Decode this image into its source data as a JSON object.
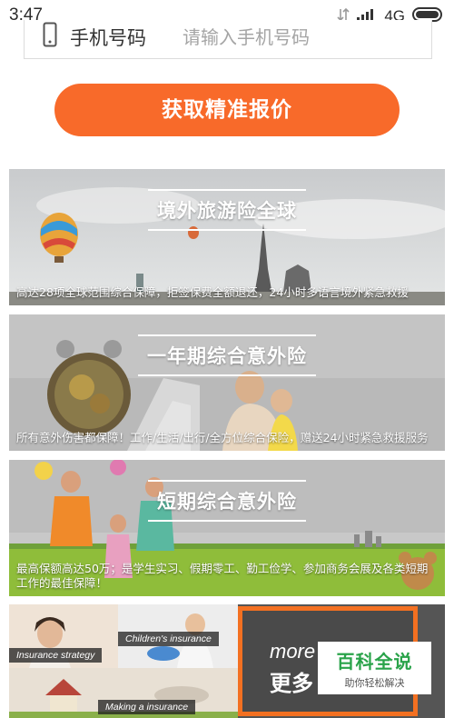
{
  "status_bar": {
    "time": "3:47",
    "network": "4G"
  },
  "phone_field": {
    "label": "手机号码",
    "placeholder": "请输入手机号码"
  },
  "cta": {
    "label": "获取精准报价"
  },
  "banners": [
    {
      "title": "境外旅游险全球",
      "desc": "高达28项全球范围综合保障，拒签保费全额退还，24小时多语言境外紧急救援"
    },
    {
      "title": "一年期综合意外险",
      "desc": "所有意外伤害都保障！工作/生活/出行/全方位综合保险，赠送24小时紧急救援服务"
    },
    {
      "title": "短期综合意外险",
      "desc": "最高保额高达50万；是学生实习、假期零工、勤工俭学、参加商务会展及各类短期工作的最佳保障！"
    }
  ],
  "more_section": {
    "tiles": [
      {
        "tag": "Insurance strategy"
      },
      {
        "tag": "Children's insurance"
      },
      {
        "tag": "Making a insurance"
      }
    ],
    "more_en": "more",
    "more_cn": "更多"
  },
  "watermark": {
    "title": "百科全说",
    "subtitle": "助你轻松解决"
  },
  "colors": {
    "accent": "#f86a2a",
    "watermark_green": "#2aa34a"
  }
}
